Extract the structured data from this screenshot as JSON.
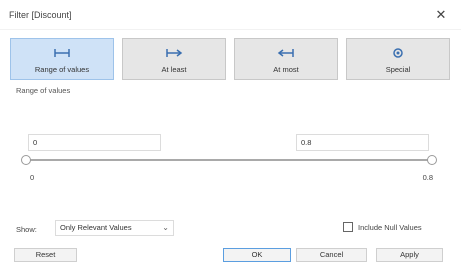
{
  "window": {
    "title": "Filter [Discount]",
    "close_glyph": "✕"
  },
  "tabs": [
    {
      "label": "Range of values",
      "icon": "range-icon",
      "active": true
    },
    {
      "label": "At least",
      "icon": "at-least-icon",
      "active": false
    },
    {
      "label": "At most",
      "icon": "at-most-icon",
      "active": false
    },
    {
      "label": "Special",
      "icon": "special-icon",
      "active": false
    }
  ],
  "range": {
    "section_label": "Range of values",
    "min_value": "0",
    "max_value": "0.8",
    "axis_min": "0",
    "axis_max": "0.8"
  },
  "show": {
    "label": "Show:",
    "selected": "Only Relevant Values",
    "chevron": "⌄"
  },
  "include_null": {
    "label": "Include Null Values",
    "checked": false
  },
  "buttons": {
    "reset": "Reset",
    "ok": "OK",
    "cancel": "Cancel",
    "apply": "Apply"
  },
  "colors": {
    "accent_tab_bg": "#cfe2f7",
    "accent_border": "#5b9ee0"
  }
}
